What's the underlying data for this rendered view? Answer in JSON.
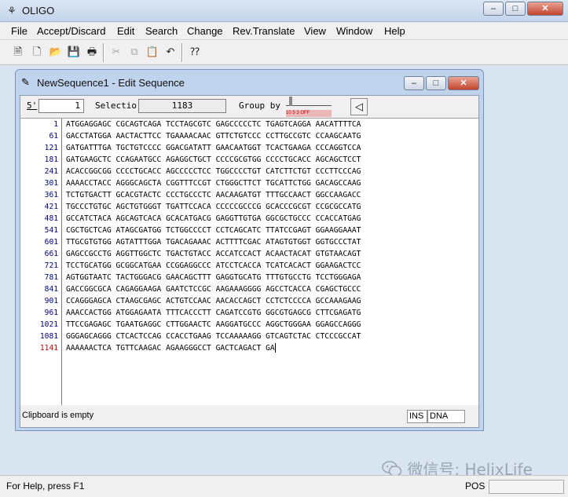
{
  "window": {
    "title": "OLIGO",
    "minimize": "–",
    "maximize": "□",
    "close": "✕"
  },
  "menu": [
    "File",
    "Accept/Discard",
    "Edit",
    "Search",
    "Change",
    "Rev.Translate",
    "View",
    "Window",
    "Help"
  ],
  "toolbar": {
    "buttons": [
      {
        "name": "new-sequence-icon",
        "glyph": "🗎",
        "disabled": false
      },
      {
        "name": "new-document-icon",
        "glyph": "🗋",
        "disabled": false
      },
      {
        "name": "open-folder-icon",
        "glyph": "📂",
        "disabled": false
      },
      {
        "name": "save-icon",
        "glyph": "💾",
        "disabled": false
      },
      {
        "name": "print-icon",
        "glyph": "🖶",
        "disabled": false
      },
      {
        "name": "cut-icon",
        "glyph": "✂",
        "disabled": true
      },
      {
        "name": "copy-icon",
        "glyph": "⧉",
        "disabled": true
      },
      {
        "name": "paste-icon",
        "glyph": "📋",
        "disabled": true
      },
      {
        "name": "undo-icon",
        "glyph": "↶",
        "disabled": false
      },
      {
        "name": "context-help-icon",
        "glyph": "⁇",
        "disabled": false
      }
    ]
  },
  "editor": {
    "title": "NewSequence1 - Edit Sequence",
    "five_prime_label": "5'",
    "position_value": "1",
    "selection_label": "Selectio",
    "selection_value": "1183",
    "group_by_label": "Group by",
    "group_by_ticks": "10   5   3  OFF",
    "rows": [
      {
        "num": "1",
        "seq": "ATGGAGGAGC CGCAGTCAGA TCCTAGCGTC GAGCCCCCTC TGAGTCAGGA AACATTTTCA"
      },
      {
        "num": "61",
        "seq": "GACCTATGGA AACTACTTCC TGAAAACAAC GTTCTGTCCC CCTTGCCGTC CCAAGCAATG"
      },
      {
        "num": "121",
        "seq": "GATGATTTGA TGCTGTCCCC GGACGATATT GAACAATGGT TCACTGAAGA CCCAGGTCCA"
      },
      {
        "num": "181",
        "seq": "GATGAAGCTC CCAGAATGCC AGAGGCTGCT CCCCGCGTGG CCCCTGCACC AGCAGCTCCT"
      },
      {
        "num": "241",
        "seq": "ACACCGGCGG CCCCTGCACC AGCCCCCTCC TGGCCCCTGT CATCTTCTGT CCCTTCCCAG"
      },
      {
        "num": "301",
        "seq": "AAAACCTACC AGGGCAGCTA CGGTTTCCGT CTGGGCTTCT TGCATTCTGG GACAGCCAAG"
      },
      {
        "num": "361",
        "seq": "TCTGTGACTT GCACGTACTC CCCTGCCCTC AACAAGATGT TTTGCCAACT GGCCAAGACC"
      },
      {
        "num": "421",
        "seq": "TGCCCTGTGC AGCTGTGGGT TGATTCCACA CCCCCGCCCG GCACCCGCGT CCGCGCCATG"
      },
      {
        "num": "481",
        "seq": "GCCATCTACA AGCAGTCACA GCACATGACG GAGGTTGTGA GGCGCTGCCC CCACCATGAG"
      },
      {
        "num": "541",
        "seq": "CGCTGCTCAG ATAGCGATGG TCTGGCCCCT CCTCAGCATC TTATCCGAGT GGAAGGAAAT"
      },
      {
        "num": "601",
        "seq": "TTGCGTGTGG AGTATTTGGA TGACAGAAAC ACTTTTCGAC ATAGTGTGGT GGTGCCCTAT"
      },
      {
        "num": "661",
        "seq": "GAGCCGCCTG AGGTTGGCTC TGACTGTACC ACCATCCACT ACAACTACAT GTGTAACAGT"
      },
      {
        "num": "721",
        "seq": "TCCTGCATGG GCGGCATGAA CCGGAGGCCC ATCCTCACCA TCATCACACT GGAAGACTCC"
      },
      {
        "num": "781",
        "seq": "AGTGGTAATC TACTGGGACG GAACAGCTTT GAGGTGCATG TTTGTGCCTG TCCTGGGAGA"
      },
      {
        "num": "841",
        "seq": "GACCGGCGCA CAGAGGAAGA GAATCTCCGC AAGAAAGGGG AGCCTCACCA CGAGCTGCCC"
      },
      {
        "num": "901",
        "seq": "CCAGGGAGCA CTAAGCGAGC ACTGTCCAAC AACACCAGCT CCTCTCCCCA GCCAAAGAAG"
      },
      {
        "num": "961",
        "seq": "AAACCACTGG ATGGAGAATA TTTCACCCTT CAGATCCGTG GGCGTGAGCG CTTCGAGATG"
      },
      {
        "num": "1021",
        "seq": "TTCCGAGAGC TGAATGAGGC CTTGGAACTC AAGGATGCCC AGGCTGGGAA GGAGCCAGGG"
      },
      {
        "num": "1081",
        "seq": "GGGAGCAGGG CTCACTCCAG CCACCTGAAG TCCAAAAAGG GTCAGTCTAC CTCCCGCCAT"
      },
      {
        "num": "1141",
        "seq": "AAAAAACTCA TGTTCAAGAC AGAAGGGCCT GACTCAGACT GA"
      }
    ],
    "status_message": "Clipboard is empty",
    "ins": "INS",
    "mode": "DNA"
  },
  "watermark": "微信号: HelixLife",
  "statusbar": {
    "message": "For Help, press F1",
    "pos": "POS"
  }
}
